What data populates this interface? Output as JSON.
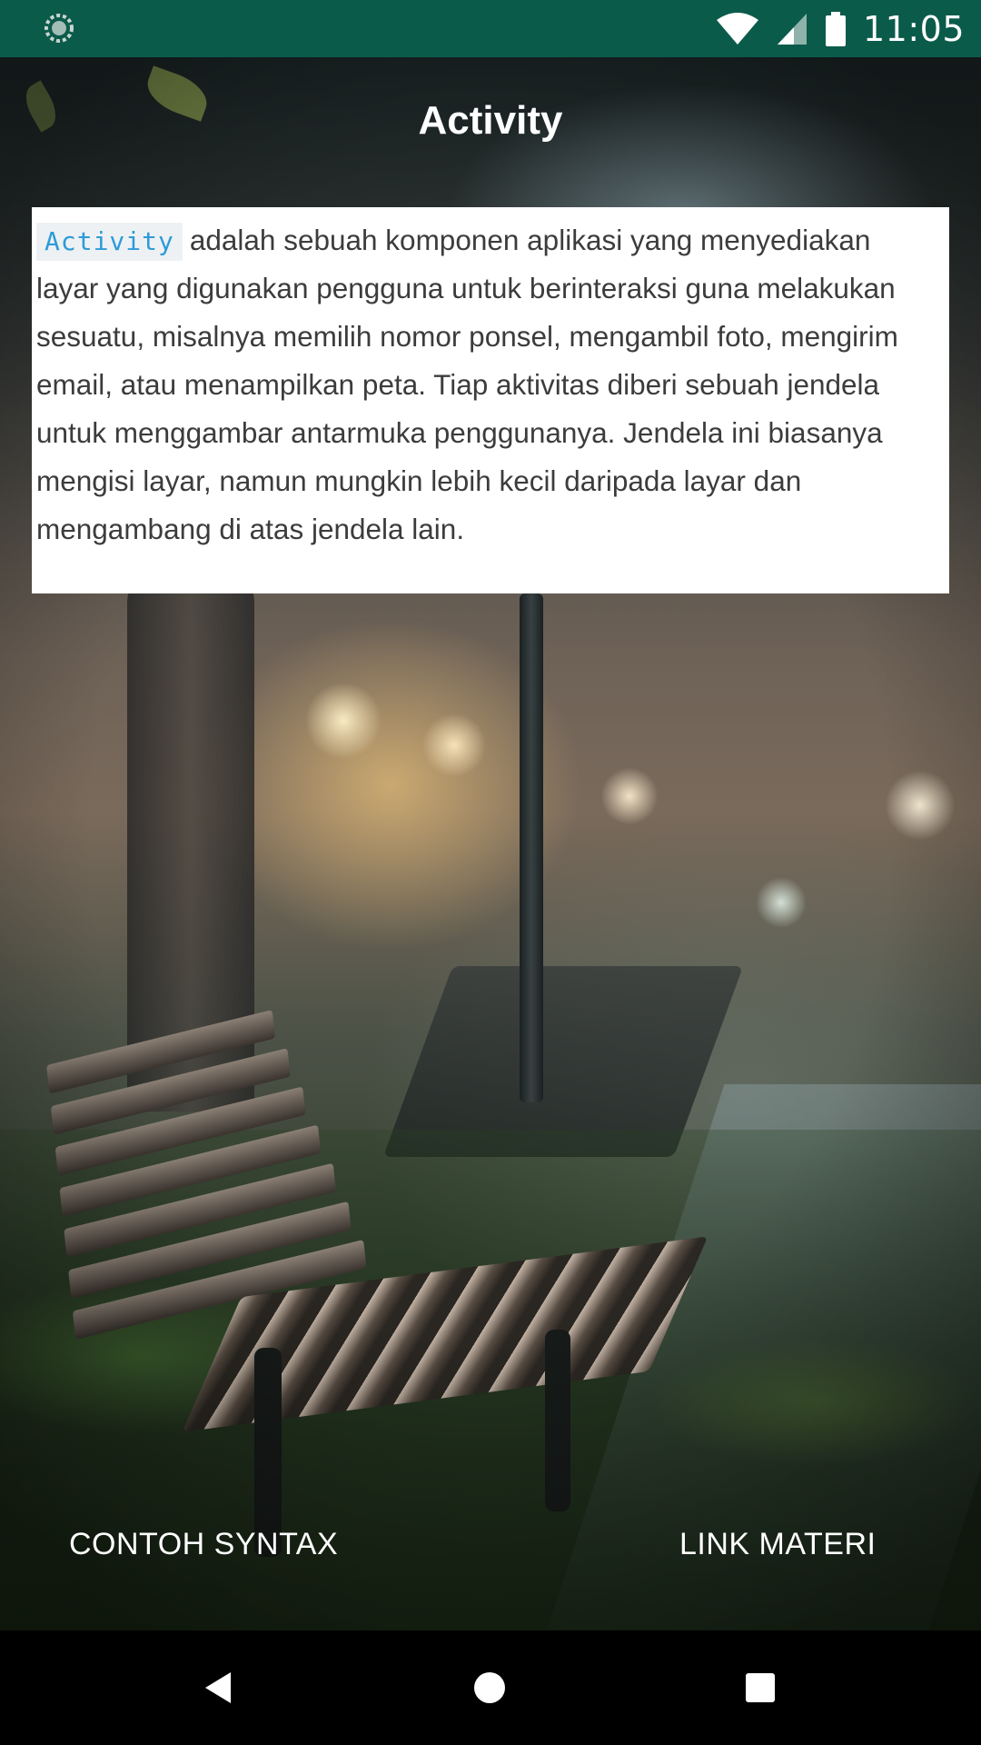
{
  "status_bar": {
    "time": "11:05",
    "background_color": "#0b5b4b",
    "icons": [
      "loading-icon",
      "wifi-icon",
      "signal-icon",
      "battery-icon"
    ]
  },
  "screen": {
    "title": "Activity"
  },
  "description": {
    "code_term": "Activity",
    "text": "adalah sebuah komponen aplikasi yang menyediakan layar yang digunakan pengguna untuk berinteraksi guna melakukan sesuatu, misalnya memilih nomor ponsel, mengambil foto, mengirim email, atau menampilkan peta. Tiap aktivitas diberi sebuah jendela untuk menggambar antarmuka penggunanya. Jendela ini biasanya mengisi layar, namun mungkin lebih kecil daripada layar dan mengambang di atas jendela lain.",
    "code_color": "#2e9bd9"
  },
  "buttons": {
    "syntax_label": "CONTOH SYNTAX",
    "link_label": "LINK MATERI"
  },
  "nav_bar": {
    "icons": [
      "back-icon",
      "home-icon",
      "recent-apps-icon"
    ]
  }
}
